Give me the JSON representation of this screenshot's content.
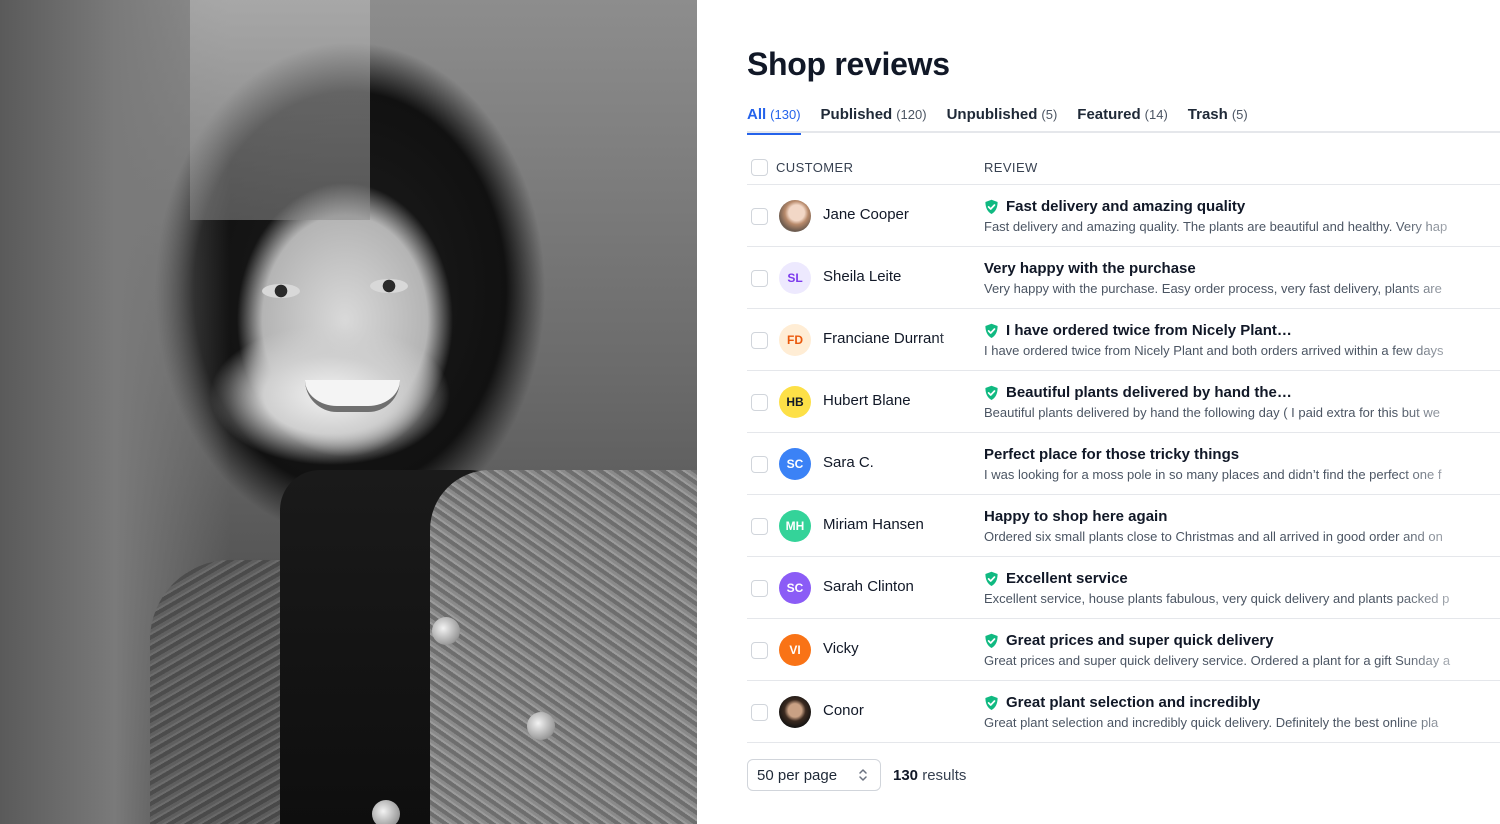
{
  "page": {
    "title": "Shop reviews"
  },
  "tabs": [
    {
      "label": "All",
      "count": "(130)",
      "active": true
    },
    {
      "label": "Published",
      "count": "(120)"
    },
    {
      "label": "Unpublished",
      "count": "(5)"
    },
    {
      "label": "Featured",
      "count": "(14)"
    },
    {
      "label": "Trash",
      "count": "(5)"
    }
  ],
  "table": {
    "customer_header": "CUSTOMER",
    "review_header": "REVIEW",
    "rows": [
      {
        "name": "Jane Cooper",
        "initials": "",
        "avatar": "photo",
        "verified": true,
        "title": "Fast delivery and amazing quality",
        "body": "Fast delivery and amazing quality. The plants are beautiful and healthy. Very hap"
      },
      {
        "name": "Sheila Leite",
        "initials": "SL",
        "avatar_bg": "#ede9fe",
        "avatar_fg": "#7c3aed",
        "verified": false,
        "title": "Very happy with the purchase",
        "body": "Very happy with the purchase. Easy order process, very fast delivery, plants are"
      },
      {
        "name": "Franciane Durrant",
        "initials": "FD",
        "avatar_bg": "#ffedd5",
        "avatar_fg": "#ea580c",
        "verified": true,
        "title": "I have ordered twice from Nicely Plant…",
        "body": "I have ordered twice from Nicely Plant and both orders arrived within a few days"
      },
      {
        "name": "Hubert Blane",
        "initials": "HB",
        "avatar_bg": "#fde047",
        "avatar_fg": "#111827",
        "verified": true,
        "title": "Beautiful plants delivered by hand the…",
        "body": "Beautiful plants delivered by hand the following day ( I paid extra for this but we"
      },
      {
        "name": "Sara C.",
        "initials": "SC",
        "avatar_bg": "#3b82f6",
        "avatar_fg": "#ffffff",
        "verified": false,
        "title": "Perfect place for those tricky things",
        "body": "I was looking for a moss pole in so many places and didn’t find the perfect one f"
      },
      {
        "name": "Miriam Hansen",
        "initials": "MH",
        "avatar_bg": "#34d399",
        "avatar_fg": "#ffffff",
        "verified": false,
        "title": "Happy to shop here again",
        "body": "Ordered six small plants close to Christmas and all arrived in good order and on"
      },
      {
        "name": "Sarah Clinton",
        "initials": "SC",
        "avatar_bg": "#8b5cf6",
        "avatar_fg": "#ffffff",
        "verified": true,
        "title": "Excellent service",
        "body": "Excellent service, house plants fabulous, very quick delivery and plants packed p"
      },
      {
        "name": "Vicky",
        "initials": "VI",
        "avatar_bg": "#f97316",
        "avatar_fg": "#ffffff",
        "verified": true,
        "title": "Great prices and super quick delivery",
        "body": "Great prices and super quick delivery service. Ordered a plant for a gift Sunday a"
      },
      {
        "name": "Conor",
        "initials": "",
        "avatar": "photo-dark",
        "verified": true,
        "title": "Great plant selection and incredibly",
        "body": "Great plant selection and incredibly quick delivery. Definitely the best online pla"
      }
    ]
  },
  "footer": {
    "per_page": "50 per page",
    "results_count": "130",
    "results_label": "results"
  },
  "colors": {
    "accent": "#2563eb",
    "verified": "#10b981"
  }
}
